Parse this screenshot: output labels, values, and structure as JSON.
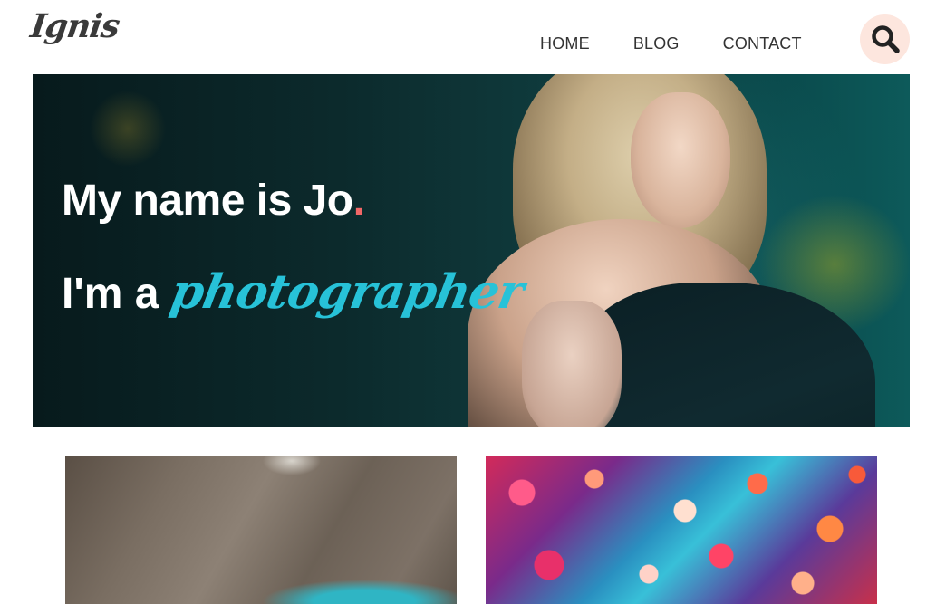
{
  "header": {
    "logo": "Ignis",
    "nav": [
      {
        "label": "HOME"
      },
      {
        "label": "BLOG"
      },
      {
        "label": "CONTACT"
      }
    ],
    "search_icon": "search-icon"
  },
  "hero": {
    "line1_text": "My name is Jo",
    "line1_dot": ".",
    "line2_prefix": "I'm a ",
    "line2_role": "photographer"
  },
  "colors": {
    "accent_coral": "#f26767",
    "accent_cyan": "#27c2d8",
    "search_bg": "#fde6de",
    "text_dark": "#333333"
  }
}
